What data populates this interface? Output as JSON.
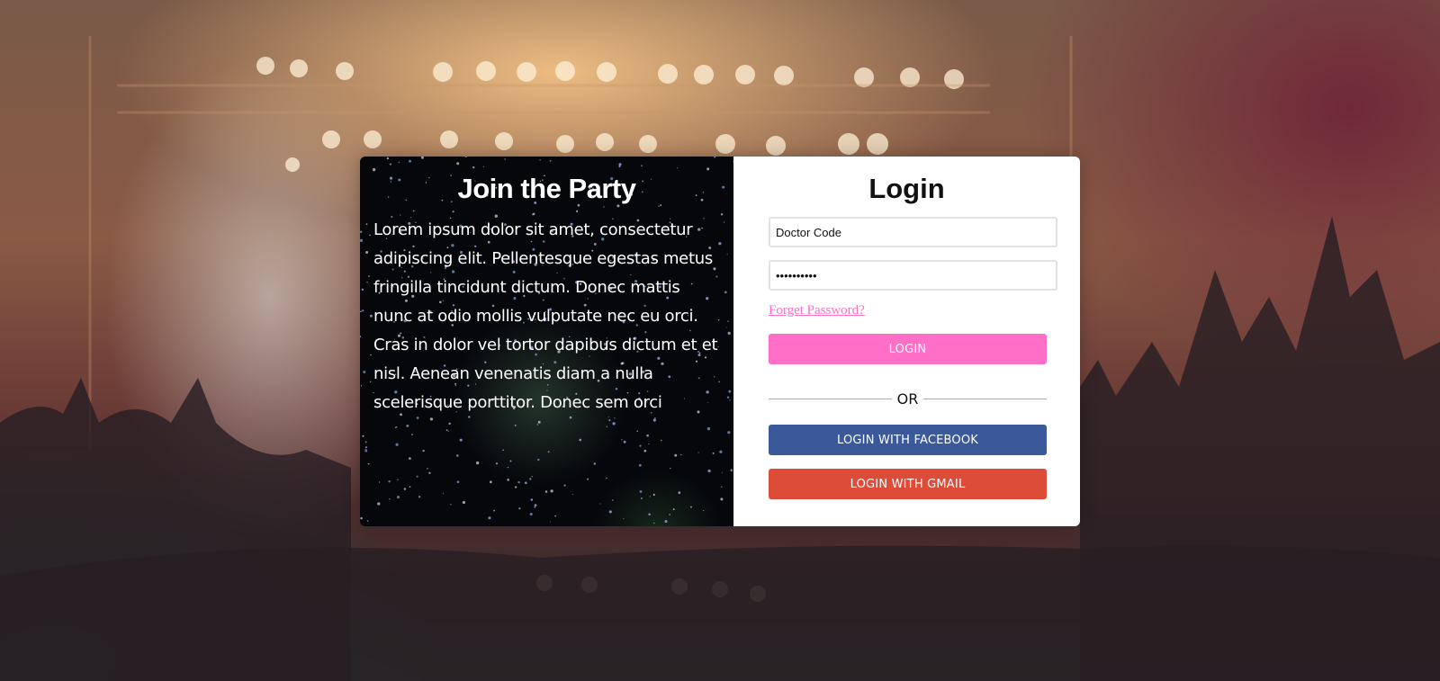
{
  "left_panel": {
    "title": "Join the Party",
    "body": "Lorem ipsum dolor sit amet, consectetur adipiscing elit. Pellentesque egestas metus fringilla tincidunt dictum. Donec mattis nunc at odio mollis vulputate nec eu orci. Cras in dolor vel tortor dapibus dictum et et nisl. Aenean venenatis diam a nulla scelerisque porttitor. Donec sem orci"
  },
  "login": {
    "title": "Login",
    "username_value": "Doctor Code",
    "password_value": "••••••••••",
    "forgot_label": "Forget Password?",
    "login_label": "LOGIN",
    "or_label": "OR",
    "facebook_label": "LOGIN WITH FACEBOOK",
    "gmail_label": "LOGIN WITH GMAIL"
  },
  "colors": {
    "accent_pink": "#ff6ec7",
    "facebook_blue": "#3b5998",
    "gmail_red": "#dd4b39"
  }
}
